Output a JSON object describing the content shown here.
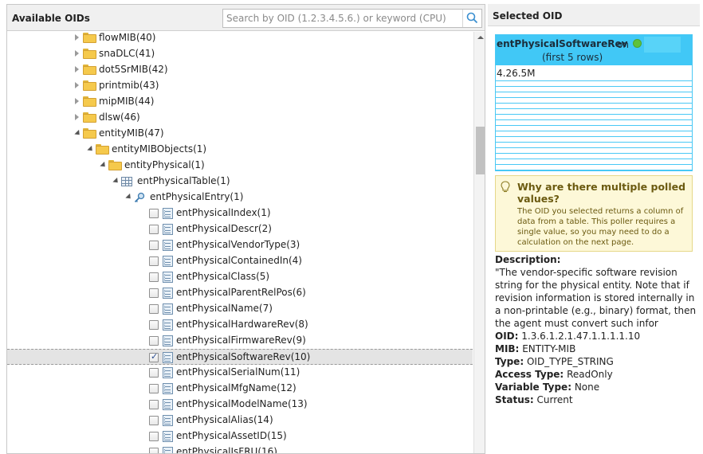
{
  "left_panel": {
    "title": "Available OIDs",
    "search_placeholder": "Search by OID (1.2.3.4.5.6.) or keyword (CPU)"
  },
  "tree": [
    {
      "label": "flowMIB(40)",
      "type": "folder",
      "indent": 0,
      "toggle": "collapsed"
    },
    {
      "label": "snaDLC(41)",
      "type": "folder",
      "indent": 0,
      "toggle": "collapsed"
    },
    {
      "label": "dot5SrMIB(42)",
      "type": "folder",
      "indent": 0,
      "toggle": "collapsed"
    },
    {
      "label": "printmib(43)",
      "type": "folder",
      "indent": 0,
      "toggle": "collapsed"
    },
    {
      "label": "mipMIB(44)",
      "type": "folder",
      "indent": 0,
      "toggle": "collapsed"
    },
    {
      "label": "dlsw(46)",
      "type": "folder",
      "indent": 0,
      "toggle": "collapsed"
    },
    {
      "label": "entityMIB(47)",
      "type": "folder",
      "indent": 0,
      "toggle": "expanded"
    },
    {
      "label": "entityMIBObjects(1)",
      "type": "folder",
      "indent": 1,
      "toggle": "expanded"
    },
    {
      "label": "entityPhysical(1)",
      "type": "folder",
      "indent": 2,
      "toggle": "expanded"
    },
    {
      "label": "entPhysicalTable(1)",
      "type": "table",
      "indent": 3,
      "toggle": "expanded"
    },
    {
      "label": "entPhysicalEntry(1)",
      "type": "entry",
      "indent": 4,
      "toggle": "expanded"
    },
    {
      "label": "entPhysicalIndex(1)",
      "type": "leaf",
      "checked": false
    },
    {
      "label": "entPhysicalDescr(2)",
      "type": "leaf",
      "checked": false
    },
    {
      "label": "entPhysicalVendorType(3)",
      "type": "leaf",
      "checked": false
    },
    {
      "label": "entPhysicalContainedIn(4)",
      "type": "leaf",
      "checked": false
    },
    {
      "label": "entPhysicalClass(5)",
      "type": "leaf",
      "checked": false
    },
    {
      "label": "entPhysicalParentRelPos(6)",
      "type": "leaf",
      "checked": false
    },
    {
      "label": "entPhysicalName(7)",
      "type": "leaf",
      "checked": false
    },
    {
      "label": "entPhysicalHardwareRev(8)",
      "type": "leaf",
      "checked": false
    },
    {
      "label": "entPhysicalFirmwareRev(9)",
      "type": "leaf",
      "checked": false
    },
    {
      "label": "entPhysicalSoftwareRev(10)",
      "type": "leaf",
      "checked": true,
      "selected": true
    },
    {
      "label": "entPhysicalSerialNum(11)",
      "type": "leaf",
      "checked": false
    },
    {
      "label": "entPhysicalMfgName(12)",
      "type": "leaf",
      "checked": false
    },
    {
      "label": "entPhysicalModelName(13)",
      "type": "leaf",
      "checked": false
    },
    {
      "label": "entPhysicalAlias(14)",
      "type": "leaf",
      "checked": false
    },
    {
      "label": "entPhysicalAssetID(15)",
      "type": "leaf",
      "checked": false
    },
    {
      "label": "entPhysicalIsFRU(16)",
      "type": "leaf",
      "checked": false
    }
  ],
  "right_panel": {
    "title": "Selected OID",
    "oid_name": "entPhysicalSoftwareRev",
    "on_label": "on",
    "node_status_color": "#5ec23b",
    "rows_note": "(first 5 rows)",
    "first_value": "4.26.5M",
    "tip_title": "Why are there multiple polled values?",
    "tip_text": "The OID you selected returns a column of data from a table. This poller requires a single value, so you may need to do a calculation on the next page.",
    "description_label": "Description:",
    "description": "\"The vendor-specific software revision string for the physical entity. Note that if revision information is stored internally in a non-printable (e.g., binary) format, then the agent must convert such infor",
    "oid_label": "OID:",
    "oid_value": "1.3.6.1.2.1.47.1.1.1.1.10",
    "mib_label": "MIB:",
    "mib_value": "ENTITY-MIB",
    "type_label": "Type:",
    "type_value": "OID_TYPE_STRING",
    "access_label": "Access Type:",
    "access_value": "ReadOnly",
    "vartype_label": "Variable Type:",
    "vartype_value": "None",
    "status_label": "Status:",
    "status_value": "Current"
  },
  "colors": {
    "accent": "#41c8f6",
    "tip_bg": "#fdf8d8",
    "folder": "#f5c94c"
  }
}
